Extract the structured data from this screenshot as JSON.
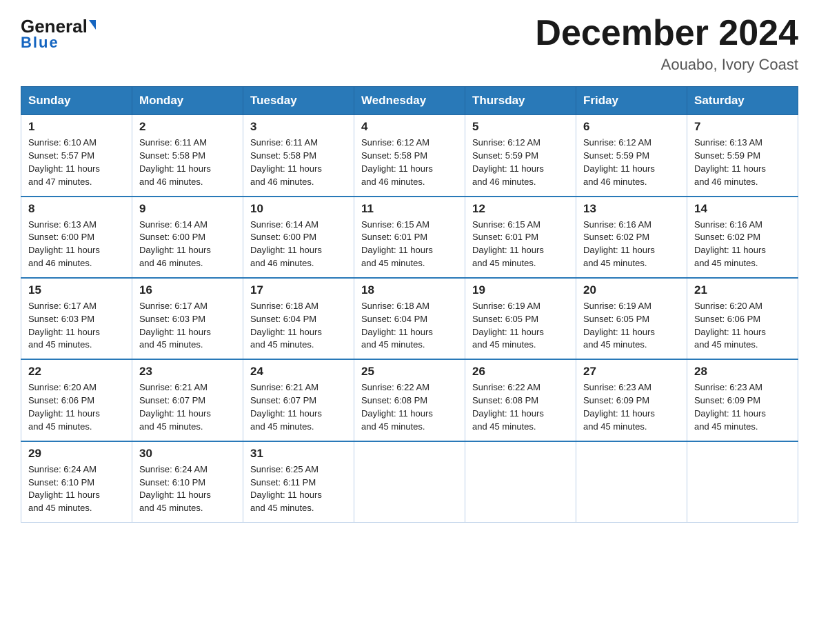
{
  "header": {
    "logo_general": "General",
    "logo_blue": "Blue",
    "month_title": "December 2024",
    "subtitle": "Aouabo, Ivory Coast"
  },
  "days_of_week": [
    "Sunday",
    "Monday",
    "Tuesday",
    "Wednesday",
    "Thursday",
    "Friday",
    "Saturday"
  ],
  "weeks": [
    [
      {
        "day": "1",
        "sunrise": "6:10 AM",
        "sunset": "5:57 PM",
        "daylight": "11 hours and 47 minutes."
      },
      {
        "day": "2",
        "sunrise": "6:11 AM",
        "sunset": "5:58 PM",
        "daylight": "11 hours and 46 minutes."
      },
      {
        "day": "3",
        "sunrise": "6:11 AM",
        "sunset": "5:58 PM",
        "daylight": "11 hours and 46 minutes."
      },
      {
        "day": "4",
        "sunrise": "6:12 AM",
        "sunset": "5:58 PM",
        "daylight": "11 hours and 46 minutes."
      },
      {
        "day": "5",
        "sunrise": "6:12 AM",
        "sunset": "5:59 PM",
        "daylight": "11 hours and 46 minutes."
      },
      {
        "day": "6",
        "sunrise": "6:12 AM",
        "sunset": "5:59 PM",
        "daylight": "11 hours and 46 minutes."
      },
      {
        "day": "7",
        "sunrise": "6:13 AM",
        "sunset": "5:59 PM",
        "daylight": "11 hours and 46 minutes."
      }
    ],
    [
      {
        "day": "8",
        "sunrise": "6:13 AM",
        "sunset": "6:00 PM",
        "daylight": "11 hours and 46 minutes."
      },
      {
        "day": "9",
        "sunrise": "6:14 AM",
        "sunset": "6:00 PM",
        "daylight": "11 hours and 46 minutes."
      },
      {
        "day": "10",
        "sunrise": "6:14 AM",
        "sunset": "6:00 PM",
        "daylight": "11 hours and 46 minutes."
      },
      {
        "day": "11",
        "sunrise": "6:15 AM",
        "sunset": "6:01 PM",
        "daylight": "11 hours and 45 minutes."
      },
      {
        "day": "12",
        "sunrise": "6:15 AM",
        "sunset": "6:01 PM",
        "daylight": "11 hours and 45 minutes."
      },
      {
        "day": "13",
        "sunrise": "6:16 AM",
        "sunset": "6:02 PM",
        "daylight": "11 hours and 45 minutes."
      },
      {
        "day": "14",
        "sunrise": "6:16 AM",
        "sunset": "6:02 PM",
        "daylight": "11 hours and 45 minutes."
      }
    ],
    [
      {
        "day": "15",
        "sunrise": "6:17 AM",
        "sunset": "6:03 PM",
        "daylight": "11 hours and 45 minutes."
      },
      {
        "day": "16",
        "sunrise": "6:17 AM",
        "sunset": "6:03 PM",
        "daylight": "11 hours and 45 minutes."
      },
      {
        "day": "17",
        "sunrise": "6:18 AM",
        "sunset": "6:04 PM",
        "daylight": "11 hours and 45 minutes."
      },
      {
        "day": "18",
        "sunrise": "6:18 AM",
        "sunset": "6:04 PM",
        "daylight": "11 hours and 45 minutes."
      },
      {
        "day": "19",
        "sunrise": "6:19 AM",
        "sunset": "6:05 PM",
        "daylight": "11 hours and 45 minutes."
      },
      {
        "day": "20",
        "sunrise": "6:19 AM",
        "sunset": "6:05 PM",
        "daylight": "11 hours and 45 minutes."
      },
      {
        "day": "21",
        "sunrise": "6:20 AM",
        "sunset": "6:06 PM",
        "daylight": "11 hours and 45 minutes."
      }
    ],
    [
      {
        "day": "22",
        "sunrise": "6:20 AM",
        "sunset": "6:06 PM",
        "daylight": "11 hours and 45 minutes."
      },
      {
        "day": "23",
        "sunrise": "6:21 AM",
        "sunset": "6:07 PM",
        "daylight": "11 hours and 45 minutes."
      },
      {
        "day": "24",
        "sunrise": "6:21 AM",
        "sunset": "6:07 PM",
        "daylight": "11 hours and 45 minutes."
      },
      {
        "day": "25",
        "sunrise": "6:22 AM",
        "sunset": "6:08 PM",
        "daylight": "11 hours and 45 minutes."
      },
      {
        "day": "26",
        "sunrise": "6:22 AM",
        "sunset": "6:08 PM",
        "daylight": "11 hours and 45 minutes."
      },
      {
        "day": "27",
        "sunrise": "6:23 AM",
        "sunset": "6:09 PM",
        "daylight": "11 hours and 45 minutes."
      },
      {
        "day": "28",
        "sunrise": "6:23 AM",
        "sunset": "6:09 PM",
        "daylight": "11 hours and 45 minutes."
      }
    ],
    [
      {
        "day": "29",
        "sunrise": "6:24 AM",
        "sunset": "6:10 PM",
        "daylight": "11 hours and 45 minutes."
      },
      {
        "day": "30",
        "sunrise": "6:24 AM",
        "sunset": "6:10 PM",
        "daylight": "11 hours and 45 minutes."
      },
      {
        "day": "31",
        "sunrise": "6:25 AM",
        "sunset": "6:11 PM",
        "daylight": "11 hours and 45 minutes."
      },
      null,
      null,
      null,
      null
    ]
  ],
  "labels": {
    "sunrise": "Sunrise:",
    "sunset": "Sunset:",
    "daylight": "Daylight:"
  }
}
